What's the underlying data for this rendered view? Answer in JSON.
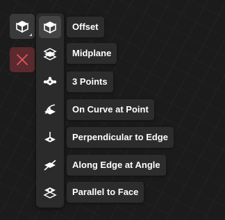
{
  "toolbar": {
    "plane_icon": "plane-cube-icon",
    "cancel_icon": "close-icon",
    "cancel_color": "#e0555f"
  },
  "menu": {
    "items": [
      {
        "label": "Offset",
        "icon": "offset-plane-icon"
      },
      {
        "label": "Midplane",
        "icon": "midplane-icon"
      },
      {
        "label": "3 Points",
        "icon": "three-points-icon"
      },
      {
        "label": "On Curve at Point",
        "icon": "curve-point-icon"
      },
      {
        "label": "Perpendicular to Edge",
        "icon": "perpendicular-edge-icon"
      },
      {
        "label": "Along Edge at Angle",
        "icon": "edge-angle-icon"
      },
      {
        "label": "Parallel to Face",
        "icon": "parallel-face-icon"
      }
    ]
  }
}
